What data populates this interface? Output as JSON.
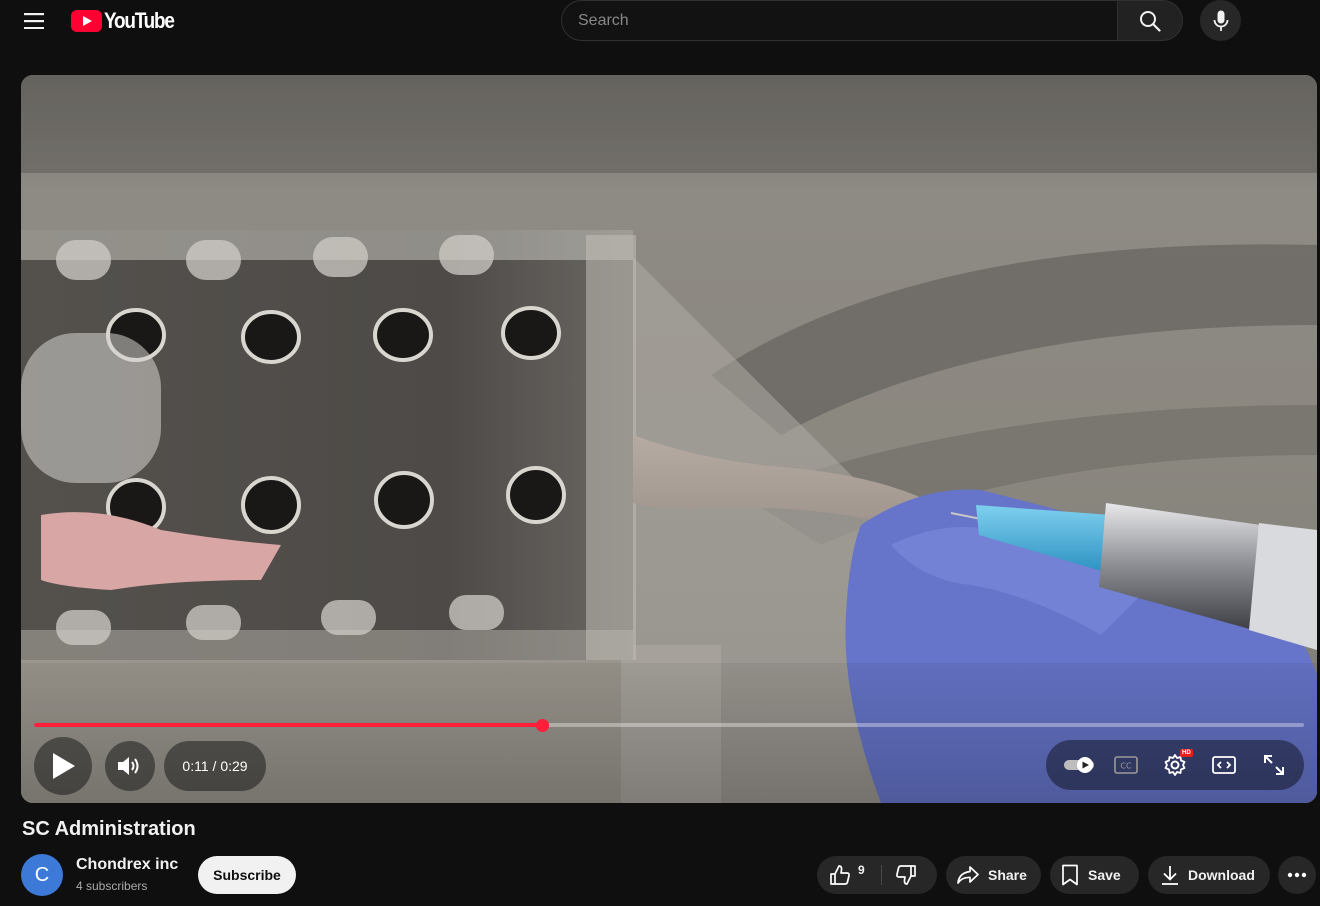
{
  "header": {
    "logo_text": "YouTube",
    "search": {
      "placeholder": "Search",
      "value": ""
    },
    "icons": [
      "menu-icon",
      "youtube-logo-icon",
      "search-icon",
      "microphone-icon"
    ]
  },
  "player": {
    "current_time": "0:11",
    "duration": "0:29",
    "time_separator": " / ",
    "progress_fraction": 0.4,
    "accent_color": "#ff1f3a",
    "hd_badge": "HD",
    "autoplay_on": true,
    "icons": [
      "play-icon",
      "volume-icon",
      "autoplay-toggle-icon",
      "closed-captions-icon",
      "settings-icon",
      "theater-mode-icon",
      "fullscreen-icon"
    ]
  },
  "video": {
    "title": "SC Administration"
  },
  "channel": {
    "avatar_letter": "C",
    "avatar_color": "#3d7ad8",
    "name": "Chondrex inc",
    "subscribers": "4 subscribers",
    "subscribe_label": "Subscribe"
  },
  "actions": {
    "like_count": "9",
    "share_label": "Share",
    "save_label": "Save",
    "download_label": "Download",
    "icons": [
      "thumbs-up-icon",
      "thumbs-down-icon",
      "share-icon",
      "bookmark-icon",
      "download-icon",
      "more-icon"
    ]
  }
}
